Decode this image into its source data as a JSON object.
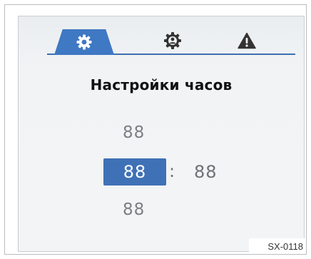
{
  "tabs": [
    {
      "icon": "gear-icon",
      "active": true
    },
    {
      "icon": "person-gear-icon",
      "active": false
    },
    {
      "icon": "warning-icon",
      "active": false
    }
  ],
  "title": "Настройки часов",
  "clock": {
    "hours_above": "88",
    "hours_selected": "88",
    "separator": ":",
    "minutes": "88",
    "hours_below": "88"
  },
  "figure_code": "SX-0118",
  "colors": {
    "accent": "#3f78c3",
    "digit_inactive": "#7c7f82",
    "title": "#111111"
  }
}
